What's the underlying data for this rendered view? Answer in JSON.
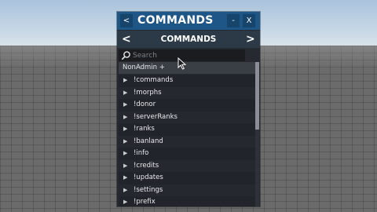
{
  "window": {
    "title": "COMMANDS",
    "back_label": "<",
    "minimize_label": "-",
    "close_label": "X"
  },
  "nav": {
    "prev_label": "<",
    "title": "COMMANDS",
    "next_label": ">"
  },
  "search": {
    "placeholder": "Search",
    "value": ""
  },
  "section": {
    "label": "NonAdmin +"
  },
  "commands": [
    "!commands",
    "!morphs",
    "!donor",
    "!serverRanks",
    "!ranks",
    "!banland",
    "!info",
    "!credits",
    "!updates",
    "!settings",
    "!prefix"
  ],
  "icons": {
    "row_expand": "triangle-right-icon",
    "search": "search-icon"
  },
  "colors": {
    "titlebar": "#1d5687",
    "navbar": "#2c3a48",
    "panel": "#262a30",
    "text": "#ffffff"
  }
}
